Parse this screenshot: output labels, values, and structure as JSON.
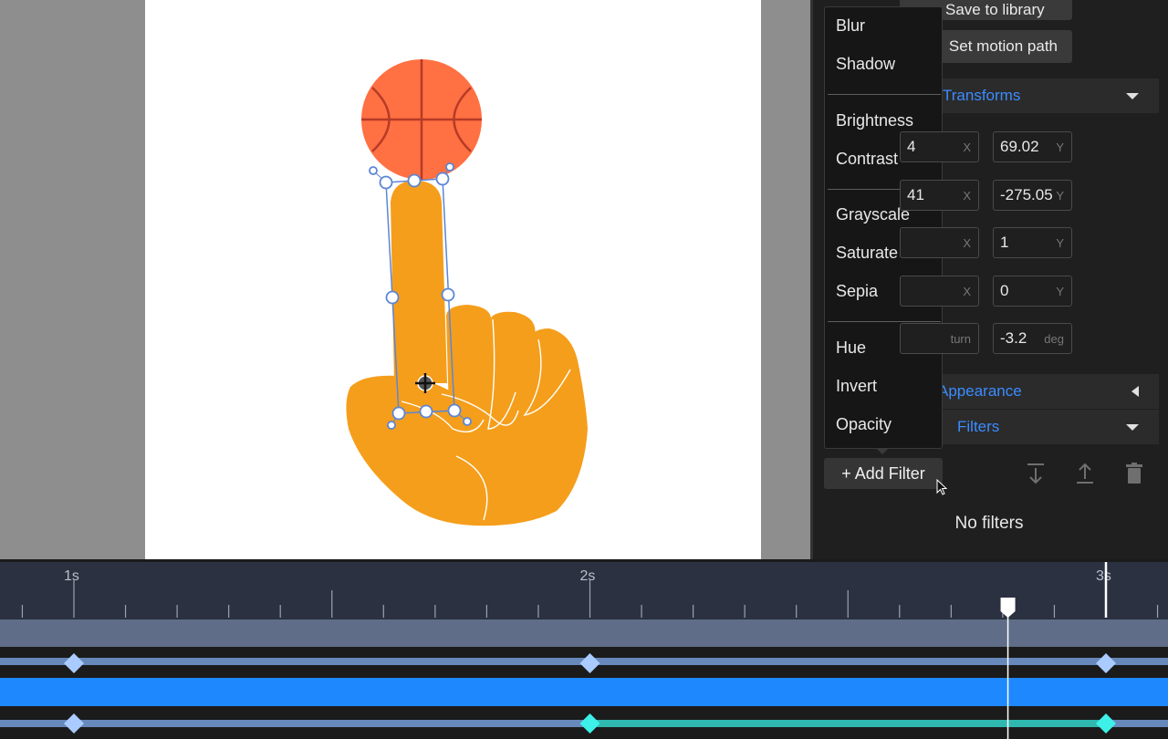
{
  "panel": {
    "save_to_library": "Save to library",
    "set_motion_path": "Set motion path",
    "transforms_title": "Transforms",
    "rows": [
      {
        "x_value": "4",
        "x_unit": "X",
        "y_value": "69.02",
        "y_unit": "Y"
      },
      {
        "x_value": "41",
        "x_unit": "X",
        "y_value": "-275.05",
        "y_unit": "Y"
      },
      {
        "x_value": "",
        "x_unit": "X",
        "y_value": "1",
        "y_unit": "Y"
      },
      {
        "x_value": "",
        "x_unit": "X",
        "y_value": "0",
        "y_unit": "Y"
      },
      {
        "x_value": "",
        "x_unit": "turn",
        "y_value": "-3.2",
        "y_unit": "deg"
      }
    ],
    "appearance_title": "Appearance",
    "filters_title": "Filters",
    "add_filter_label": "+ Add Filter",
    "no_filters": "No filters"
  },
  "filter_menu": {
    "groups": [
      [
        "Blur",
        "Shadow"
      ],
      [
        "Brightness",
        "Contrast"
      ],
      [
        "Grayscale",
        "Saturate",
        "Sepia"
      ],
      [
        "Hue",
        "Invert",
        "Opacity"
      ]
    ]
  },
  "timeline": {
    "time_labels": [
      "1s",
      "2s",
      "3s"
    ],
    "playhead_time_s": 2.81,
    "keyframe_times_s": [
      1.0,
      2.0,
      3.0
    ]
  },
  "colors": {
    "accent": "#3b8cff",
    "track_blue": "#1e88ff",
    "keyframe": "#a9cbff",
    "keyframe_active": "#3df0e8",
    "ball": "#ff7043",
    "hand": "#f59e1b"
  }
}
